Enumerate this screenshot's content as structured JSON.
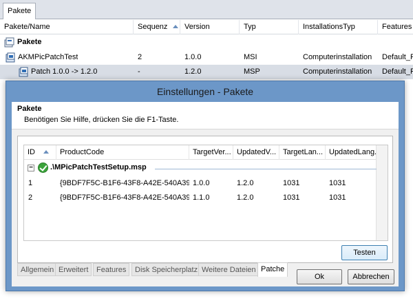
{
  "top_tab": {
    "label": "Pakete"
  },
  "packages": {
    "columns": [
      "Pakete/Name",
      "Sequenz",
      "Version",
      "Typ",
      "InstallationsTyp",
      "Features"
    ],
    "group_label": "Pakete",
    "rows": [
      {
        "name": "AKMPicPatchTest",
        "sequence": "2",
        "version": "1.0.0",
        "type": "MSI",
        "install_type": "Computerinstallation",
        "features": "Default_Fe"
      },
      {
        "name": "Patch 1.0.0 -> 1.2.0",
        "sequence": "-",
        "version": "1.2.0",
        "type": "MSP",
        "install_type": "Computerinstallation",
        "features": "Default_Fe"
      }
    ]
  },
  "dialog": {
    "title": "Einstellungen - Pakete",
    "section_title": "Pakete",
    "hint": "Benötigen Sie Hilfe, drücken Sie die F1-Taste.",
    "grid": {
      "columns": [
        "ID",
        "ProductCode",
        "TargetVer...",
        "UpdatedV...",
        "TargetLan...",
        "UpdatedLang..."
      ],
      "group_label": ".\\MPicPatchTestSetup.msp",
      "rows": [
        {
          "id": "1",
          "product_code": "{9BDF7F5C-B1F6-43F8-A42E-540A39...",
          "target_ver": "1.0.0",
          "updated_ver": "1.2.0",
          "target_lang": "1031",
          "updated_lang": "1031"
        },
        {
          "id": "2",
          "product_code": "{9BDF7F5C-B1F6-43F8-A42E-540A39...",
          "target_ver": "1.1.0",
          "updated_ver": "1.2.0",
          "target_lang": "1031",
          "updated_lang": "1031"
        }
      ]
    },
    "test_button": "Testen",
    "tabs": [
      "Allgemein",
      "Erweitert",
      "Features",
      "Disk Speicherplatz",
      "Weitere Dateien",
      "Patche"
    ],
    "active_tab": "Patche",
    "ok_button": "Ok",
    "cancel_button": "Abbrechen"
  },
  "colors": {
    "dialog_frame": "#6c97c8",
    "selected_row": "#d8dde5",
    "check_green": "#3aa33a"
  }
}
